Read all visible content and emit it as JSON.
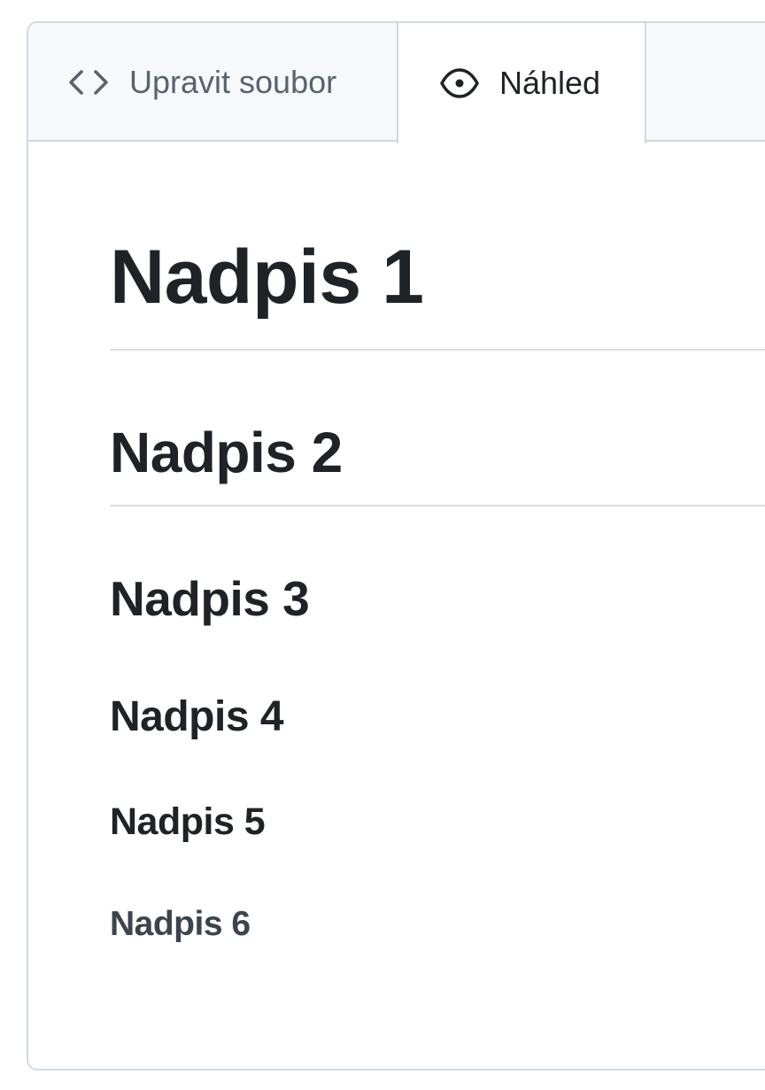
{
  "tabs": {
    "edit": {
      "label": "Upravit soubor",
      "icon": "code-icon"
    },
    "preview": {
      "label": "Náhled",
      "icon": "eye-icon",
      "active": true
    }
  },
  "preview": {
    "h1": "Nadpis 1",
    "h2": "Nadpis 2",
    "h3": "Nadpis 3",
    "h4": "Nadpis 4",
    "h5": "Nadpis 5",
    "h6": "Nadpis 6"
  },
  "colors": {
    "text": "#1f2328",
    "muted": "#59636e",
    "border": "#d1d9e0",
    "tabbar_bg": "#f6f8fa"
  }
}
